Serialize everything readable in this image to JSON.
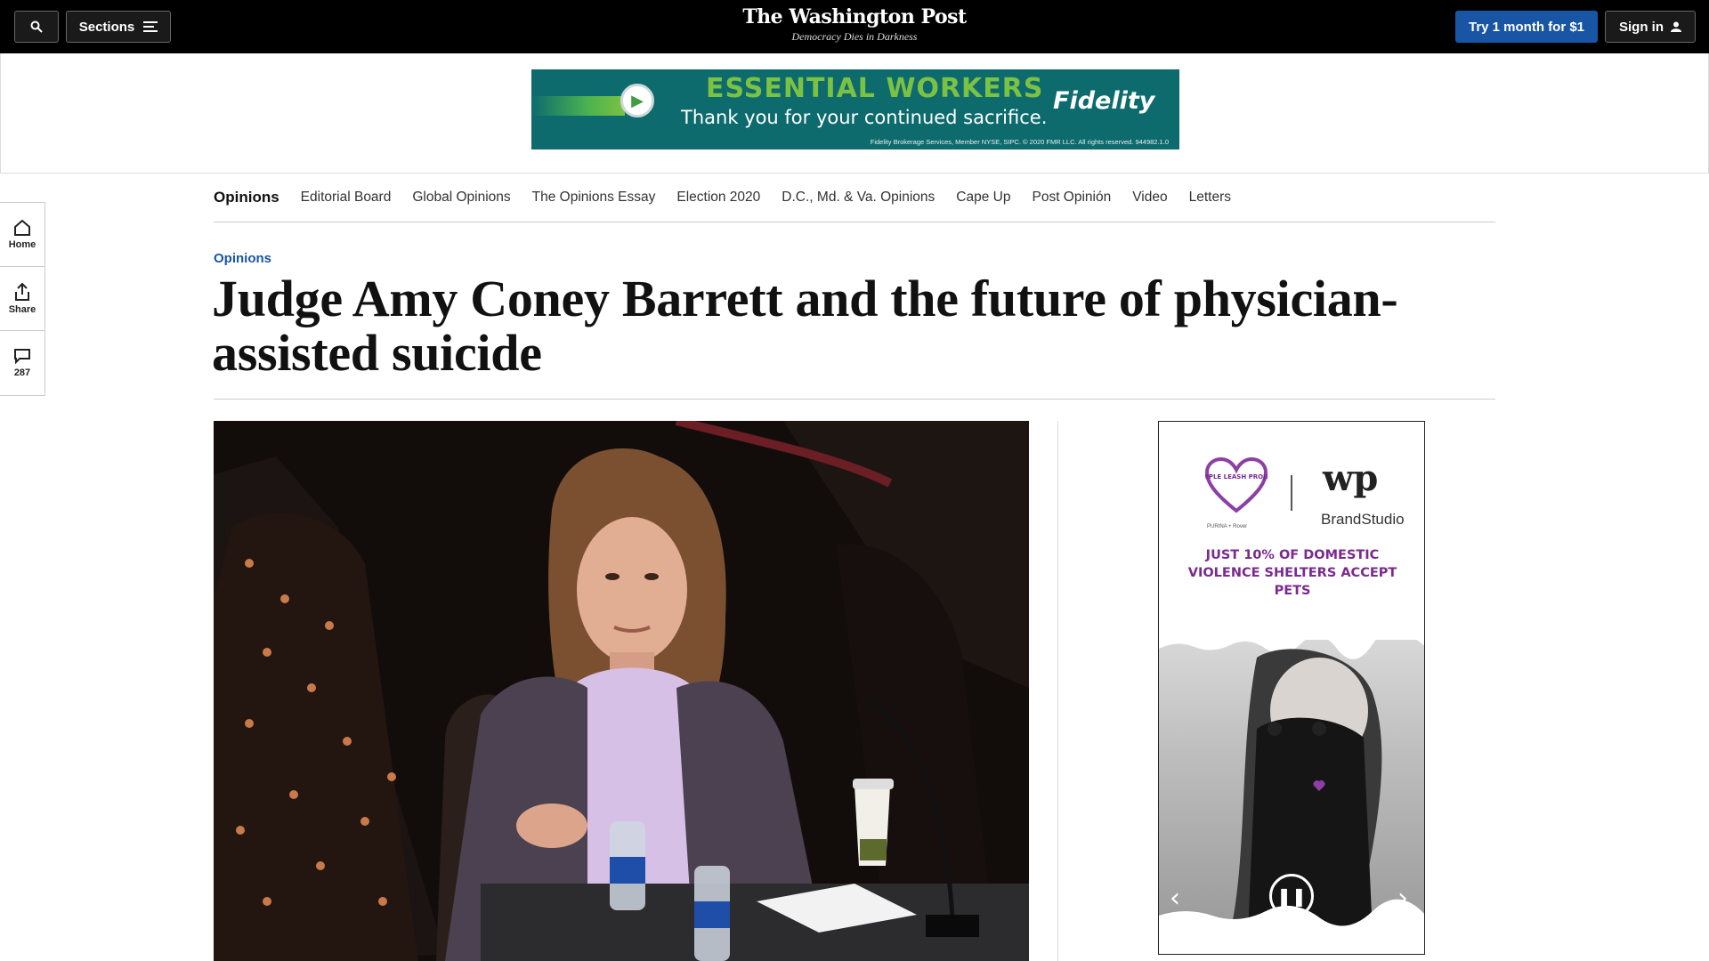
{
  "header": {
    "sections_label": "Sections",
    "logo": "The Washington Post",
    "tagline": "Democracy Dies in Darkness",
    "try_label": "Try 1 month for $1",
    "signin_label": "Sign in"
  },
  "leaderboard_ad": {
    "headline": "ESSENTIAL WORKERS",
    "subline": "Thank you for your continued sacrifice.",
    "brand": "Fidelity",
    "fineprint": "Fidelity Brokerage Services, Member NYSE, SIPC. © 2020 FMR LLC. All rights reserved. 944982.1.0"
  },
  "rail": {
    "home_label": "Home",
    "share_label": "Share",
    "comments_count": "287"
  },
  "section_nav": {
    "current": "Opinions",
    "items": [
      "Editorial Board",
      "Global Opinions",
      "The Opinions Essay",
      "Election 2020",
      "D.C., Md. & Va. Opinions",
      "Cape Up",
      "Post Opinión",
      "Video",
      "Letters"
    ]
  },
  "article": {
    "kicker": "Opinions",
    "headline": "Judge Amy Coney Barrett and the future of physician-assisted suicide"
  },
  "side_ad": {
    "logo_text": "PURPLE LEASH PROJECT",
    "wp_mark": "wp",
    "brandstudio": "BrandStudio",
    "sponsor_line": "PURINA + Rover",
    "message": "JUST 10% OF DOMESTIC VIOLENCE SHELTERS ACCEPT PETS"
  },
  "colors": {
    "accent_blue": "#1955a5",
    "ad_teal": "#0d6b6e",
    "ad_green": "#7cc242",
    "ad_purple": "#7a2a8e"
  }
}
